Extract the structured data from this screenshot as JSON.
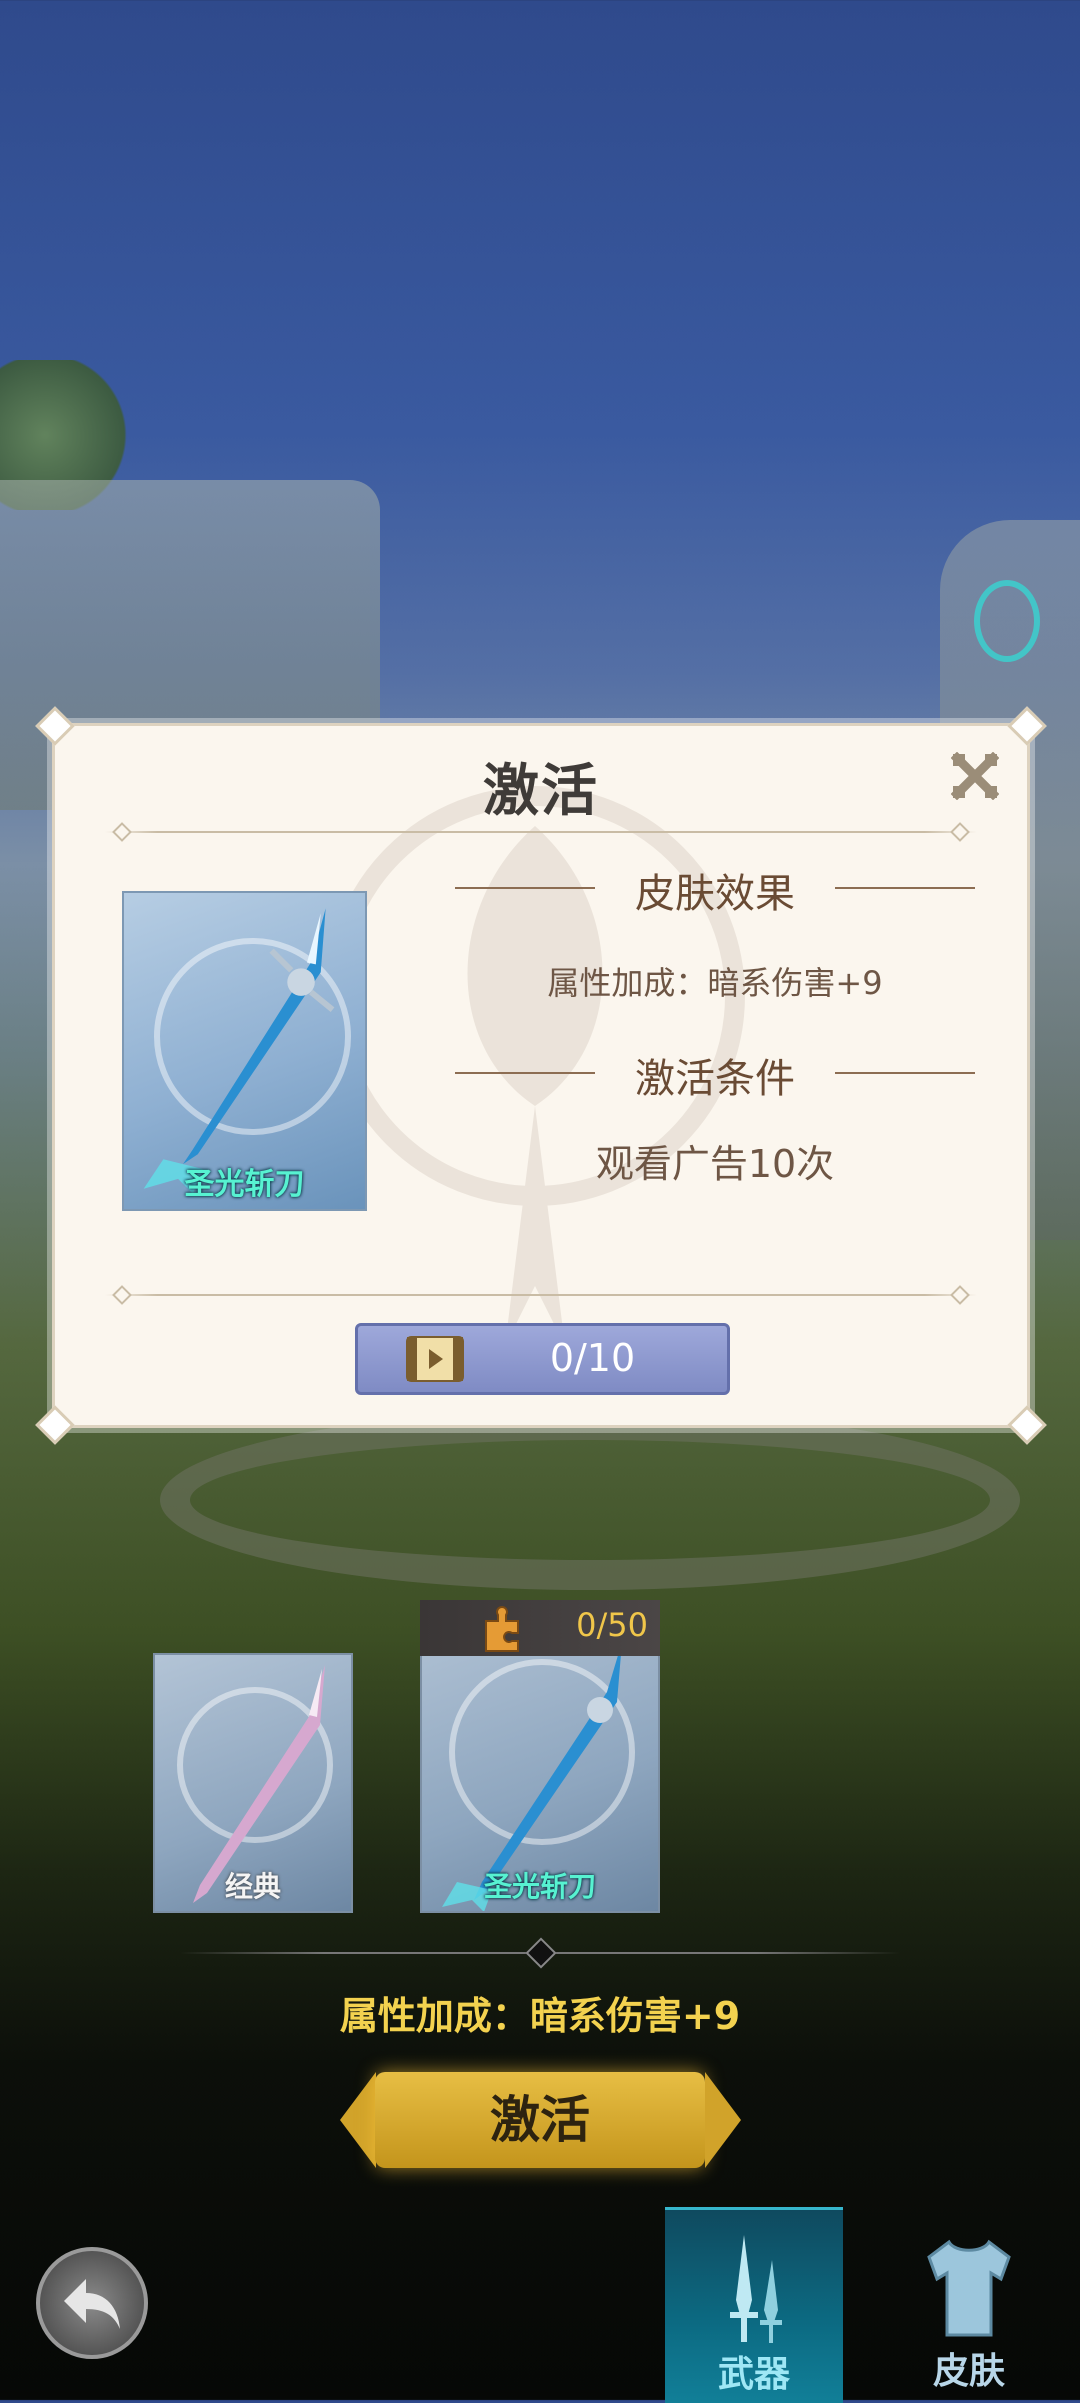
{
  "dialog": {
    "title": "激活",
    "skin_card": {
      "name": "圣光斩刀"
    },
    "effect_header": "皮肤效果",
    "effect_text": "属性加成：暗系伤害+9",
    "condition_header": "激活条件",
    "condition_text": "观看广告10次",
    "progress_text": "0/10",
    "icons": {
      "close": "close-icon",
      "video": "video-icon"
    }
  },
  "skins": [
    {
      "name": "经典"
    },
    {
      "name": "圣光斩刀",
      "fragments": "0/50"
    }
  ],
  "attribute_bonus": "属性加成：暗系伤害+9",
  "activate_label": "激活",
  "tabs": [
    {
      "label": "武器",
      "selected": true
    },
    {
      "label": "皮肤",
      "selected": false
    }
  ],
  "colors": {
    "accent_gold": "#f3d24f",
    "skin_name_teal": "#57f2d1",
    "dialog_bg": "#fbf6ee",
    "tab_active": "#0c6b83"
  }
}
